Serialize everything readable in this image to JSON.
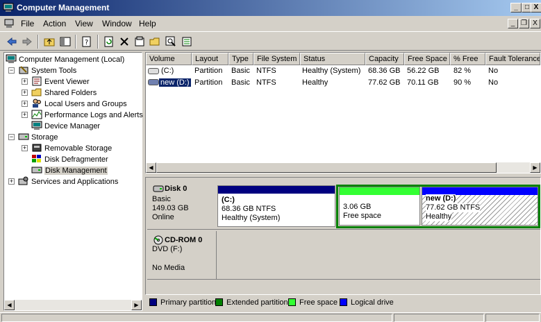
{
  "window": {
    "title": "Computer Management",
    "controls": [
      "_",
      "□",
      "X"
    ]
  },
  "menu": {
    "items": [
      "File",
      "Action",
      "View",
      "Window",
      "Help"
    ],
    "mdi_controls": [
      "_",
      "❐",
      "X"
    ]
  },
  "toolbar": {
    "buttons": [
      "back-icon",
      "forward-icon",
      "up-icon",
      "show-hide-tree-icon",
      "properties-icon",
      "refresh-icon",
      "delete-icon",
      "help-icon",
      "open-icon",
      "search-icon",
      "export-icon"
    ]
  },
  "tree": {
    "items": [
      {
        "label": "Computer Management (Local)",
        "icon": "computer-icon"
      },
      {
        "label": "System Tools",
        "icon": "tools-icon"
      },
      {
        "label": "Event Viewer",
        "icon": "event-viewer-icon"
      },
      {
        "label": "Shared Folders",
        "icon": "folder-icon"
      },
      {
        "label": "Local Users and Groups",
        "icon": "users-icon"
      },
      {
        "label": "Performance Logs and Alerts",
        "icon": "performance-icon"
      },
      {
        "label": "Device Manager",
        "icon": "device-manager-icon"
      },
      {
        "label": "Storage",
        "icon": "storage-icon"
      },
      {
        "label": "Removable Storage",
        "icon": "removable-storage-icon"
      },
      {
        "label": "Disk Defragmenter",
        "icon": "defragmenter-icon"
      },
      {
        "label": "Disk Management",
        "icon": "disk-management-icon"
      },
      {
        "label": "Services and Applications",
        "icon": "services-icon"
      }
    ],
    "expanders": {
      "minus": "−",
      "plus": "+"
    }
  },
  "volume_list": {
    "columns": [
      "Volume",
      "Layout",
      "Type",
      "File System",
      "Status",
      "Capacity",
      "Free Space",
      "% Free",
      "Fault Tolerance"
    ],
    "rows": [
      {
        "volume": "(C:)",
        "layout": "Partition",
        "type": "Basic",
        "fs": "NTFS",
        "status": "Healthy (System)",
        "capacity": "68.36 GB",
        "free": "56.22 GB",
        "pct_free": "82 %",
        "fault": "No"
      },
      {
        "volume": "new (D:)",
        "layout": "Partition",
        "type": "Basic",
        "fs": "NTFS",
        "status": "Healthy",
        "capacity": "77.62 GB",
        "free": "70.11 GB",
        "pct_free": "90 %",
        "fault": "No"
      }
    ]
  },
  "disks": {
    "disk0": {
      "name": "Disk 0",
      "type": "Basic",
      "size": "149.03 GB",
      "state": "Online",
      "partitions": [
        {
          "title": "(C:)",
          "line2": "68.36 GB NTFS",
          "line3": "Healthy (System)"
        },
        {
          "title": "",
          "line2": "3.06 GB",
          "line3": "Free space"
        },
        {
          "title": "new  (D:)",
          "line2": "77.62 GB NTFS",
          "line3": "Healthy"
        }
      ]
    },
    "cdrom0": {
      "name": "CD-ROM 0",
      "drive": "DVD (F:)",
      "media": "No Media"
    }
  },
  "legend": {
    "items": [
      {
        "label": "Primary partition",
        "color": "#000080"
      },
      {
        "label": "Extended partition",
        "color": "#008000"
      },
      {
        "label": "Free space",
        "color": "#33ff33"
      },
      {
        "label": "Logical drive",
        "color": "#0000ff"
      }
    ]
  },
  "colors": {
    "primary": "#000080",
    "extended": "#008000",
    "free": "#33ff33",
    "logical": "#0000ff",
    "selection": "#0a246a"
  }
}
